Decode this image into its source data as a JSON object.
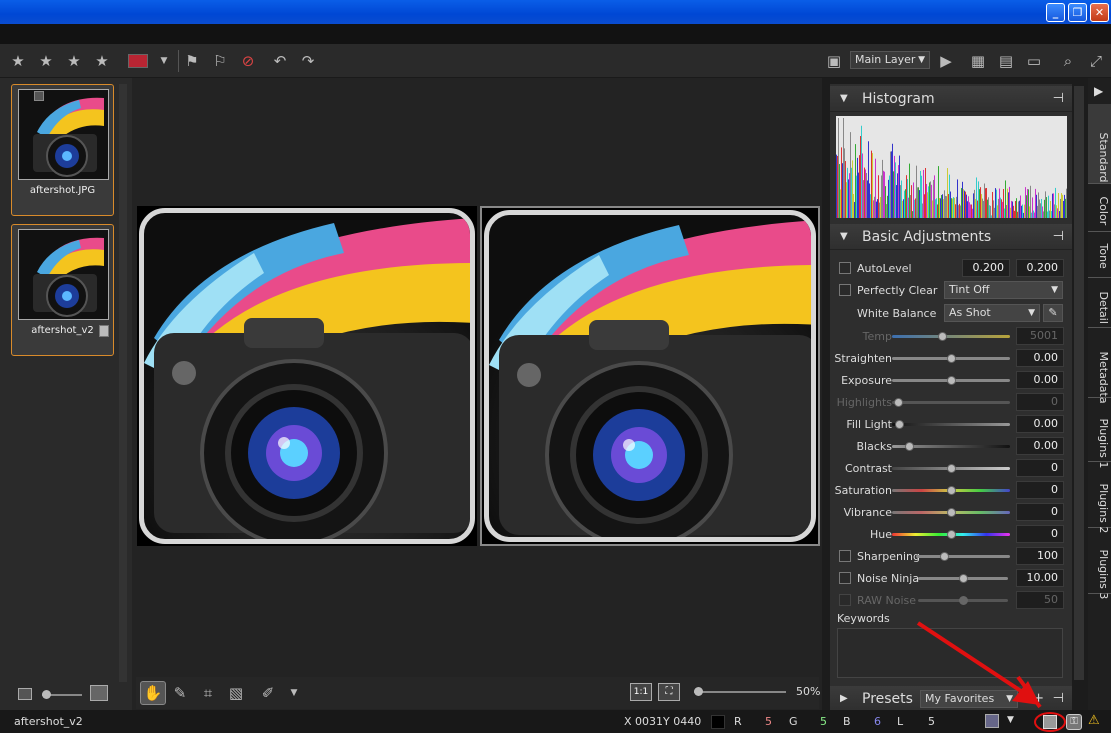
{
  "window": {
    "min_label": "_",
    "restore_label": "❐",
    "close_label": "✕"
  },
  "toolbar": {
    "stars": [
      "★",
      "★",
      "★",
      "★"
    ],
    "layer_select": "Main Layer",
    "accent_color": "#b82533"
  },
  "filmstrip": {
    "items": [
      {
        "label": "aftershot.JPG"
      },
      {
        "label": "aftershot_v2"
      }
    ]
  },
  "viewbar": {
    "one_to_one": "1:1",
    "zoom": "50%"
  },
  "histogram": {
    "title": "Histogram"
  },
  "basic": {
    "title": "Basic Adjustments",
    "autolevel": {
      "label": "AutoLevel",
      "v1": "0.200",
      "v2": "0.200"
    },
    "perfectly_clear": {
      "label": "Perfectly Clear",
      "tint": "Tint Off"
    },
    "white_balance": {
      "label": "White Balance",
      "value": "As Shot"
    },
    "temp": {
      "label": "Temp",
      "value": "5001",
      "pos": 0.42
    },
    "straighten": {
      "label": "Straighten",
      "value": "0.00",
      "pos": 0.5
    },
    "exposure": {
      "label": "Exposure",
      "value": "0.00",
      "pos": 0.5
    },
    "highlights": {
      "label": "Highlights",
      "value": "0",
      "pos": 0.05
    },
    "fill_light": {
      "label": "Fill Light",
      "value": "0.00",
      "pos": 0.06
    },
    "blacks": {
      "label": "Blacks",
      "value": "0.00",
      "pos": 0.14
    },
    "contrast": {
      "label": "Contrast",
      "value": "0",
      "pos": 0.5
    },
    "saturation": {
      "label": "Saturation",
      "value": "0",
      "pos": 0.5
    },
    "vibrance": {
      "label": "Vibrance",
      "value": "0",
      "pos": 0.5
    },
    "hue": {
      "label": "Hue",
      "value": "0",
      "pos": 0.5
    },
    "sharpening": {
      "label": "Sharpening",
      "value": "100",
      "pos": 0.3
    },
    "noise_ninja": {
      "label": "Noise Ninja",
      "value": "10.00",
      "pos": 0.5
    },
    "raw_noise": {
      "label": "RAW Noise",
      "value": "50",
      "pos": 0.5
    },
    "keywords": {
      "label": "Keywords"
    }
  },
  "presets": {
    "title": "Presets",
    "value": "My Favorites"
  },
  "sidetabs": [
    "Standard",
    "Color",
    "Tone",
    "Detail",
    "Metadata",
    "Plugins 1",
    "Plugins 2",
    "Plugins 3"
  ],
  "status": {
    "filename": "aftershot_v2",
    "x": "X 0031",
    "y": "Y 0440",
    "r_label": "R",
    "r_val": "5",
    "g_label": "G",
    "g_val": "5",
    "b_label": "B",
    "b_val": "6",
    "l_label": "L",
    "l_val": "5"
  },
  "colors": {
    "selection_orange": "#d98b2b",
    "annotation_red": "#e01010"
  }
}
